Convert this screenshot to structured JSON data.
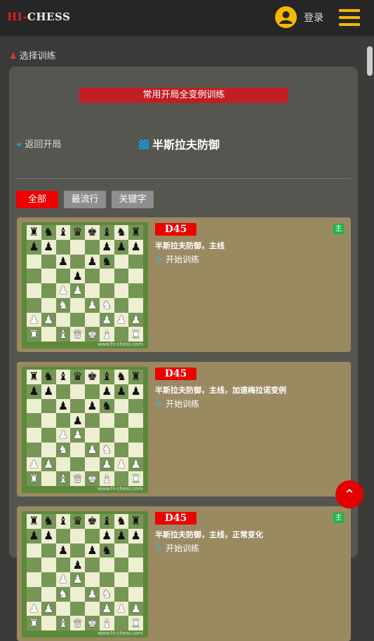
{
  "header": {
    "logo_hi": "HI-",
    "logo_chess": "CHESS",
    "login_label": "登录"
  },
  "section_label": "选择训练",
  "panel": {
    "banner": "常用开局全变例训练",
    "back_label": "返回开局",
    "title": "半斯拉夫防御"
  },
  "filters": [
    {
      "label": "全部",
      "active": true
    },
    {
      "label": "最流行",
      "active": false
    },
    {
      "label": "关键字",
      "active": false
    }
  ],
  "cards": [
    {
      "code": "D45",
      "badge": "主",
      "desc": "半斯拉夫防御，主线",
      "start_label": "开始训练",
      "watermark": "www.hi-chess.com"
    },
    {
      "code": "D45",
      "badge": "",
      "desc": "半斯拉夫防御，主线，加速梅拉诺变例",
      "start_label": "开始训练",
      "watermark": "www.hi-chess.com"
    },
    {
      "code": "D45",
      "badge": "主",
      "desc": "半斯拉夫防御，主线，正常变化",
      "start_label": "开始训练",
      "watermark": "www.hi-chess.com"
    }
  ],
  "colors": {
    "accent_red": "#ee0000",
    "accent_yellow": "#f5b800",
    "card_bg": "#9a8a62"
  },
  "icons": {
    "user": "user-circle-icon",
    "menu": "hamburger-menu-icon",
    "back": "double-chevron-left-icon",
    "title": "grid-icon",
    "start": "arrow-right-icon",
    "to_top": "chevron-up-icon"
  }
}
